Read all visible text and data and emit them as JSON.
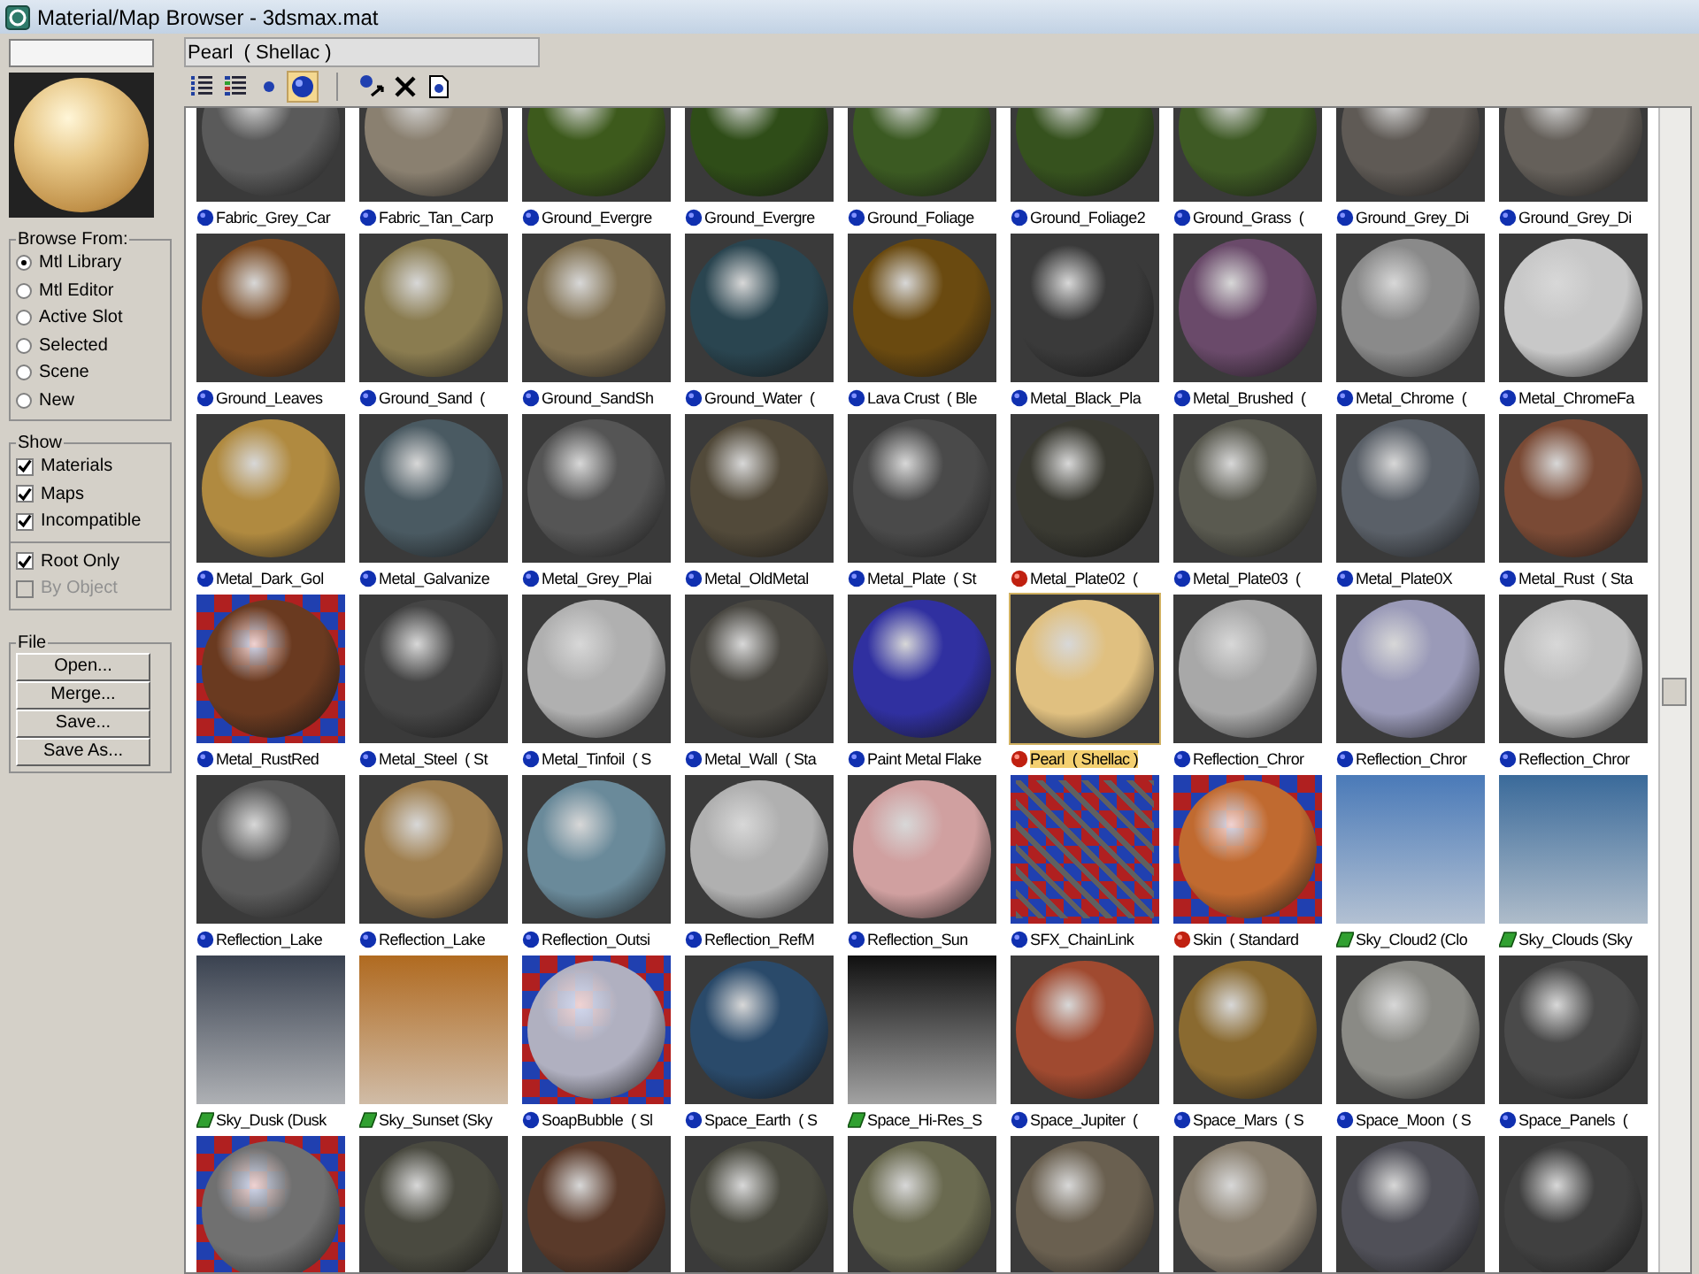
{
  "window": {
    "title": "Material/Map Browser - 3dsmax.mat"
  },
  "name_field": {
    "value": "Pearl  ( Shellac )"
  },
  "browse_from": {
    "title": "Browse From:",
    "options": [
      {
        "label": "Mtl Library",
        "selected": true
      },
      {
        "label": "Mtl Editor",
        "selected": false
      },
      {
        "label": "Active Slot",
        "selected": false
      },
      {
        "label": "Selected",
        "selected": false
      },
      {
        "label": "Scene",
        "selected": false
      },
      {
        "label": "New",
        "selected": false
      }
    ]
  },
  "show": {
    "title": "Show",
    "options": [
      {
        "label": "Materials",
        "checked": true,
        "disabled": false
      },
      {
        "label": "Maps",
        "checked": true,
        "disabled": false
      },
      {
        "label": "Incompatible",
        "checked": true,
        "disabled": false
      }
    ],
    "options_2": [
      {
        "label": "Root Only",
        "checked": true,
        "disabled": false
      },
      {
        "label": "By Object",
        "checked": false,
        "disabled": true
      }
    ]
  },
  "file": {
    "title": "File",
    "buttons": [
      "Open...",
      "Merge...",
      "Save...",
      "Save As..."
    ]
  },
  "view_buttons": [
    {
      "kind": "list",
      "selected": false
    },
    {
      "kind": "list-icons",
      "selected": false
    },
    {
      "kind": "small-icons",
      "selected": false
    },
    {
      "kind": "large-icons",
      "selected": true
    }
  ],
  "action_buttons": [
    {
      "kind": "update"
    },
    {
      "kind": "delete"
    },
    {
      "kind": "clear"
    }
  ],
  "items": [
    {
      "label": "Fabric_Grey_Car",
      "kind": "material",
      "color": "#5a5a5a",
      "selected": false
    },
    {
      "label": "Fabric_Tan_Carp",
      "kind": "material",
      "color": "#8a8070",
      "selected": false
    },
    {
      "label": "Ground_Evergre",
      "kind": "material",
      "color": "#3d5a1c",
      "selected": false
    },
    {
      "label": "Ground_Evergre",
      "kind": "material",
      "color": "#2f4d18",
      "selected": false
    },
    {
      "label": "Ground_Foliage",
      "kind": "material",
      "color": "#3b5a22",
      "selected": false
    },
    {
      "label": "Ground_Foliage2",
      "kind": "material",
      "color": "#36521e",
      "selected": false
    },
    {
      "label": "Ground_Grass  (",
      "kind": "material",
      "color": "#3e5a24",
      "selected": false
    },
    {
      "label": "Ground_Grey_Di",
      "kind": "material",
      "color": "#5f5a55",
      "selected": false
    },
    {
      "label": "Ground_Grey_Di",
      "kind": "material",
      "color": "#65605a",
      "selected": false
    },
    {
      "label": "Ground_Leaves",
      "kind": "material",
      "color": "#7a4a22",
      "selected": false
    },
    {
      "label": "Ground_Sand  (",
      "kind": "material",
      "color": "#8a7c50",
      "selected": false
    },
    {
      "label": "Ground_SandSh",
      "kind": "material",
      "color": "#807050",
      "selected": false
    },
    {
      "label": "Ground_Water  (",
      "kind": "material",
      "color": "#2a4550",
      "selected": false
    },
    {
      "label": "Lava Crust  ( Ble",
      "kind": "material",
      "color": "#6a4a10",
      "selected": false
    },
    {
      "label": "Metal_Black_Pla",
      "kind": "material",
      "color": "#3a3a3a",
      "selected": false
    },
    {
      "label": "Metal_Brushed  (",
      "kind": "material",
      "color": "#6a4a6a",
      "selected": false
    },
    {
      "label": "Metal_Chrome  (",
      "kind": "material",
      "color": "#8a8a8a",
      "selected": false
    },
    {
      "label": "Metal_ChromeFa",
      "kind": "material",
      "color": "#c8c8c8",
      "selected": false
    },
    {
      "label": "Metal_Dark_Gol",
      "kind": "material",
      "color": "#b08a40",
      "selected": false
    },
    {
      "label": "Metal_Galvanize",
      "kind": "material",
      "color": "#4a5a62",
      "selected": false
    },
    {
      "label": "Metal_Grey_Plai",
      "kind": "material",
      "color": "#555555",
      "selected": false
    },
    {
      "label": "Metal_OldMetal",
      "kind": "material",
      "color": "#524a3a",
      "selected": false
    },
    {
      "label": "Metal_Plate  ( St",
      "kind": "material",
      "color": "#4a4a4a",
      "selected": false
    },
    {
      "label": "Metal_Plate02  (",
      "kind": "multi",
      "color": "#3a3a32",
      "selected": false
    },
    {
      "label": "Metal_Plate03  (",
      "kind": "material",
      "color": "#5a5a50",
      "selected": false
    },
    {
      "label": "Metal_Plate0X",
      "kind": "material",
      "color": "#5a6068",
      "selected": false
    },
    {
      "label": "Metal_Rust  ( Sta",
      "kind": "material",
      "color": "#7a4a35",
      "selected": false
    },
    {
      "label": "Metal_RustRed",
      "kind": "material-checker",
      "color": "#6a3a20",
      "selected": false
    },
    {
      "label": "Metal_Steel  ( St",
      "kind": "material",
      "color": "#454545",
      "selected": false
    },
    {
      "label": "Metal_Tinfoil  ( S",
      "kind": "material",
      "color": "#b0b0b0",
      "selected": false
    },
    {
      "label": "Metal_Wall  ( Sta",
      "kind": "material",
      "color": "#4a4842",
      "selected": false
    },
    {
      "label": "Paint Metal Flake",
      "kind": "material",
      "color": "#3030a0",
      "selected": false
    },
    {
      "label": "Pearl  ( Shellac )",
      "kind": "multi",
      "color": "#e0c080",
      "selected": true
    },
    {
      "label": "Reflection_Chror",
      "kind": "material",
      "color": "#a8a8a8",
      "selected": false
    },
    {
      "label": "Reflection_Chror",
      "kind": "material",
      "color": "#9a9ab8",
      "selected": false
    },
    {
      "label": "Reflection_Chror",
      "kind": "material",
      "color": "#c0c0c0",
      "selected": false
    },
    {
      "label": "Reflection_Lake",
      "kind": "material",
      "color": "#5a5a5a",
      "selected": false
    },
    {
      "label": "Reflection_Lake",
      "kind": "material",
      "color": "#a08050",
      "selected": false
    },
    {
      "label": "Reflection_Outsi",
      "kind": "material",
      "color": "#6a8a9a",
      "selected": false
    },
    {
      "label": "Reflection_RefM",
      "kind": "material",
      "color": "#b0b0b0",
      "selected": false
    },
    {
      "label": "Reflection_Sun",
      "kind": "material",
      "color": "#d0a0a0",
      "selected": false
    },
    {
      "label": "SFX_ChainLink",
      "kind": "material-mesh",
      "color": "#606060",
      "selected": false
    },
    {
      "label": "Skin  ( Standard",
      "kind": "multi-checker",
      "color": "#c06a30",
      "selected": false
    },
    {
      "label": "Sky_Cloud2 (Clo",
      "kind": "map",
      "color": "#4a7ab8",
      "selected": false
    },
    {
      "label": "Sky_Clouds (Sky",
      "kind": "map",
      "color": "#3a6a9a",
      "selected": false
    },
    {
      "label": "Sky_Dusk (Dusk",
      "kind": "map",
      "color": "#3a4250",
      "selected": false
    },
    {
      "label": "Sky_Sunset (Sky",
      "kind": "map",
      "color": "#b06a20",
      "selected": false
    },
    {
      "label": "SoapBubble  ( Sl",
      "kind": "material-checker",
      "color": "#b0b0c0",
      "selected": false
    },
    {
      "label": "Space_Earth  ( S",
      "kind": "material",
      "color": "#2a4a6a",
      "selected": false
    },
    {
      "label": "Space_Hi-Res_S",
      "kind": "map",
      "color": "#101010",
      "selected": false
    },
    {
      "label": "Space_Jupiter  (",
      "kind": "material",
      "color": "#a04a30",
      "selected": false
    },
    {
      "label": "Space_Mars  ( S",
      "kind": "material",
      "color": "#8a6a30",
      "selected": false
    },
    {
      "label": "Space_Moon  ( S",
      "kind": "material",
      "color": "#8a8a85",
      "selected": false
    },
    {
      "label": "Space_Panels  (",
      "kind": "material",
      "color": "#4a4a4a",
      "selected": false
    }
  ],
  "partial_row": [
    {
      "color": "#707070",
      "kind": "material-checker"
    },
    {
      "color": "#4a4a40",
      "kind": "material"
    },
    {
      "color": "#5a3a2a",
      "kind": "material"
    },
    {
      "color": "#4a4a40",
      "kind": "material"
    },
    {
      "color": "#6a6a50",
      "kind": "material"
    },
    {
      "color": "#6a6050",
      "kind": "material"
    },
    {
      "color": "#8a8070",
      "kind": "material"
    },
    {
      "color": "#505058",
      "kind": "material"
    },
    {
      "color": "#404040",
      "kind": "material"
    }
  ]
}
